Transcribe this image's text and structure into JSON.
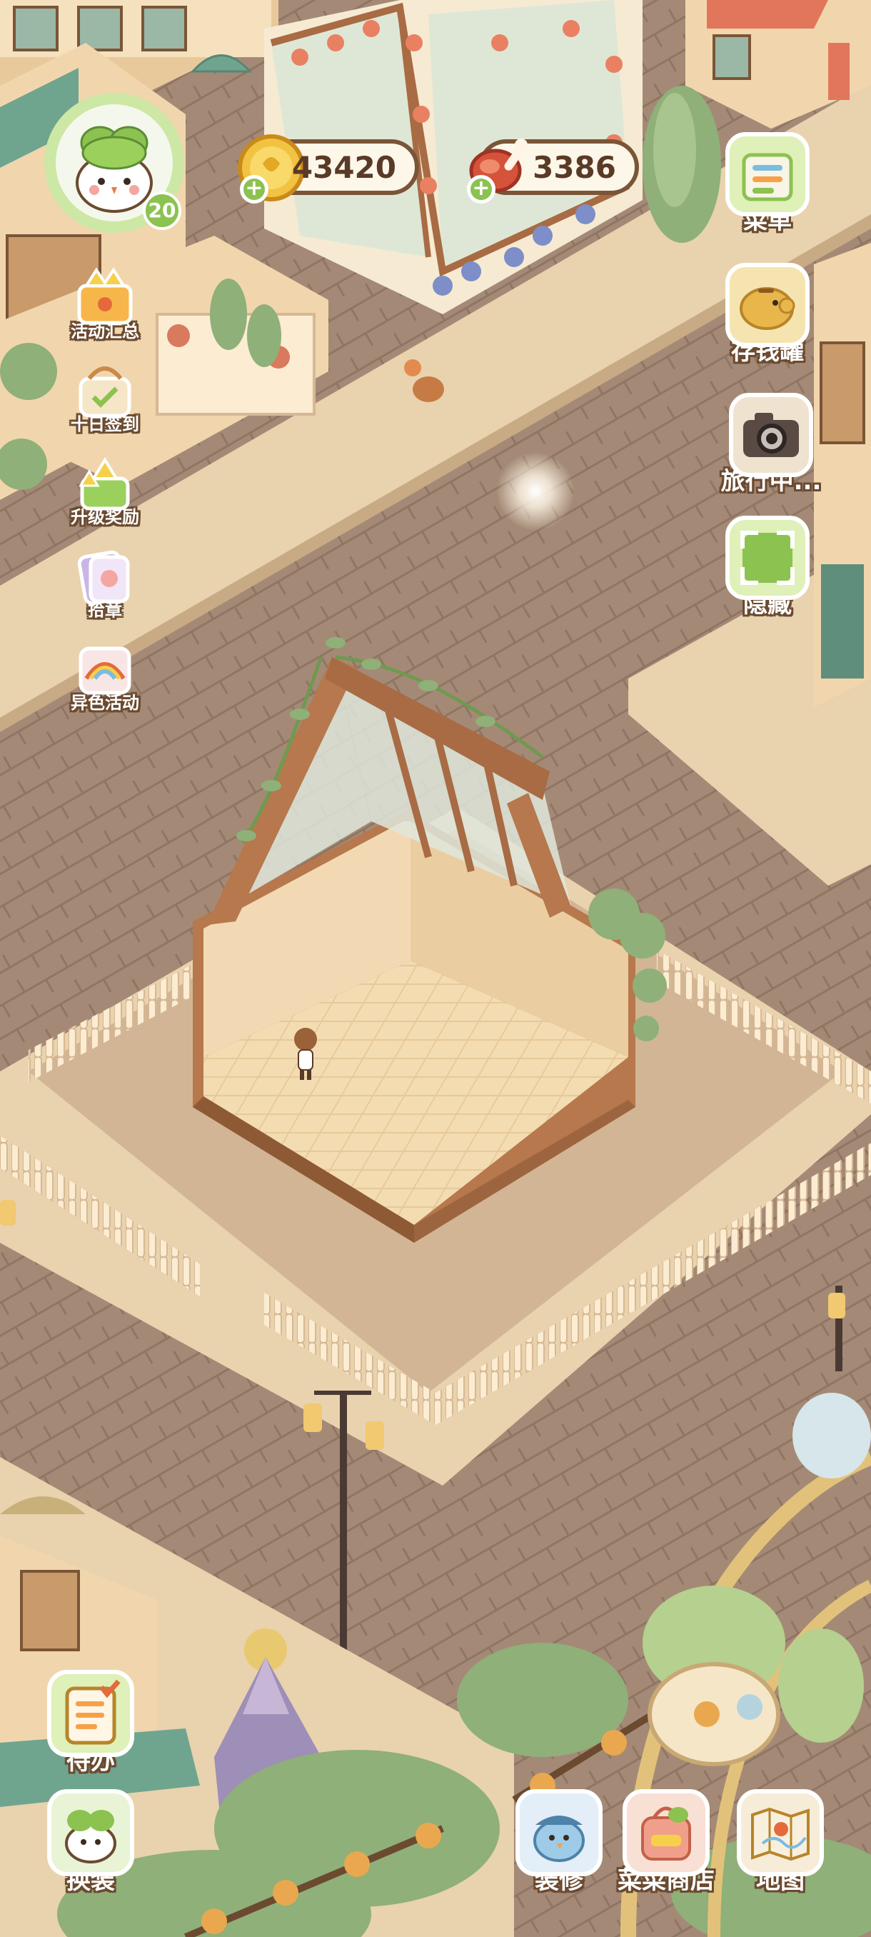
{
  "player": {
    "level": "20",
    "avatar_icon": "bunny-sprout-avatar-icon"
  },
  "currencies": {
    "coins": {
      "value": "43420",
      "icon": "gold-coin-icon"
    },
    "meat": {
      "value": "3386",
      "icon": "meat-drumstick-icon"
    }
  },
  "left_menu": [
    {
      "label": "活动汇总",
      "icon": "crown-house-icon"
    },
    {
      "label": "十日签到",
      "icon": "checkin-basket-icon"
    },
    {
      "label": "升级奖励",
      "icon": "level-up-arrows-icon"
    },
    {
      "label": "拾章",
      "icon": "sticker-pack-icon"
    },
    {
      "label": "异色活动",
      "icon": "rainbow-card-icon"
    }
  ],
  "right_menu": [
    {
      "label": "菜单",
      "icon": "menu-list-icon"
    },
    {
      "label": "存钱罐",
      "icon": "piggy-bank-icon"
    },
    {
      "label": "旅行中...",
      "icon": "camera-icon"
    },
    {
      "label": "隐藏",
      "icon": "hide-frame-icon"
    }
  ],
  "bottom_left_menu": [
    {
      "label": "待办",
      "icon": "todo-clipboard-icon"
    },
    {
      "label": "换装",
      "icon": "outfit-sprout-icon"
    }
  ],
  "bottom_right_menu": [
    {
      "label": "装修",
      "icon": "renovate-bird-icon"
    },
    {
      "label": "菜菜商店",
      "icon": "shop-backpack-icon"
    },
    {
      "label": "地图",
      "icon": "map-icon"
    }
  ],
  "colors": {
    "pavement": "#a48a76",
    "sidewalk": "#e9d2ae",
    "wood": "#b6784c",
    "ui_outline": "#6b4a30"
  }
}
